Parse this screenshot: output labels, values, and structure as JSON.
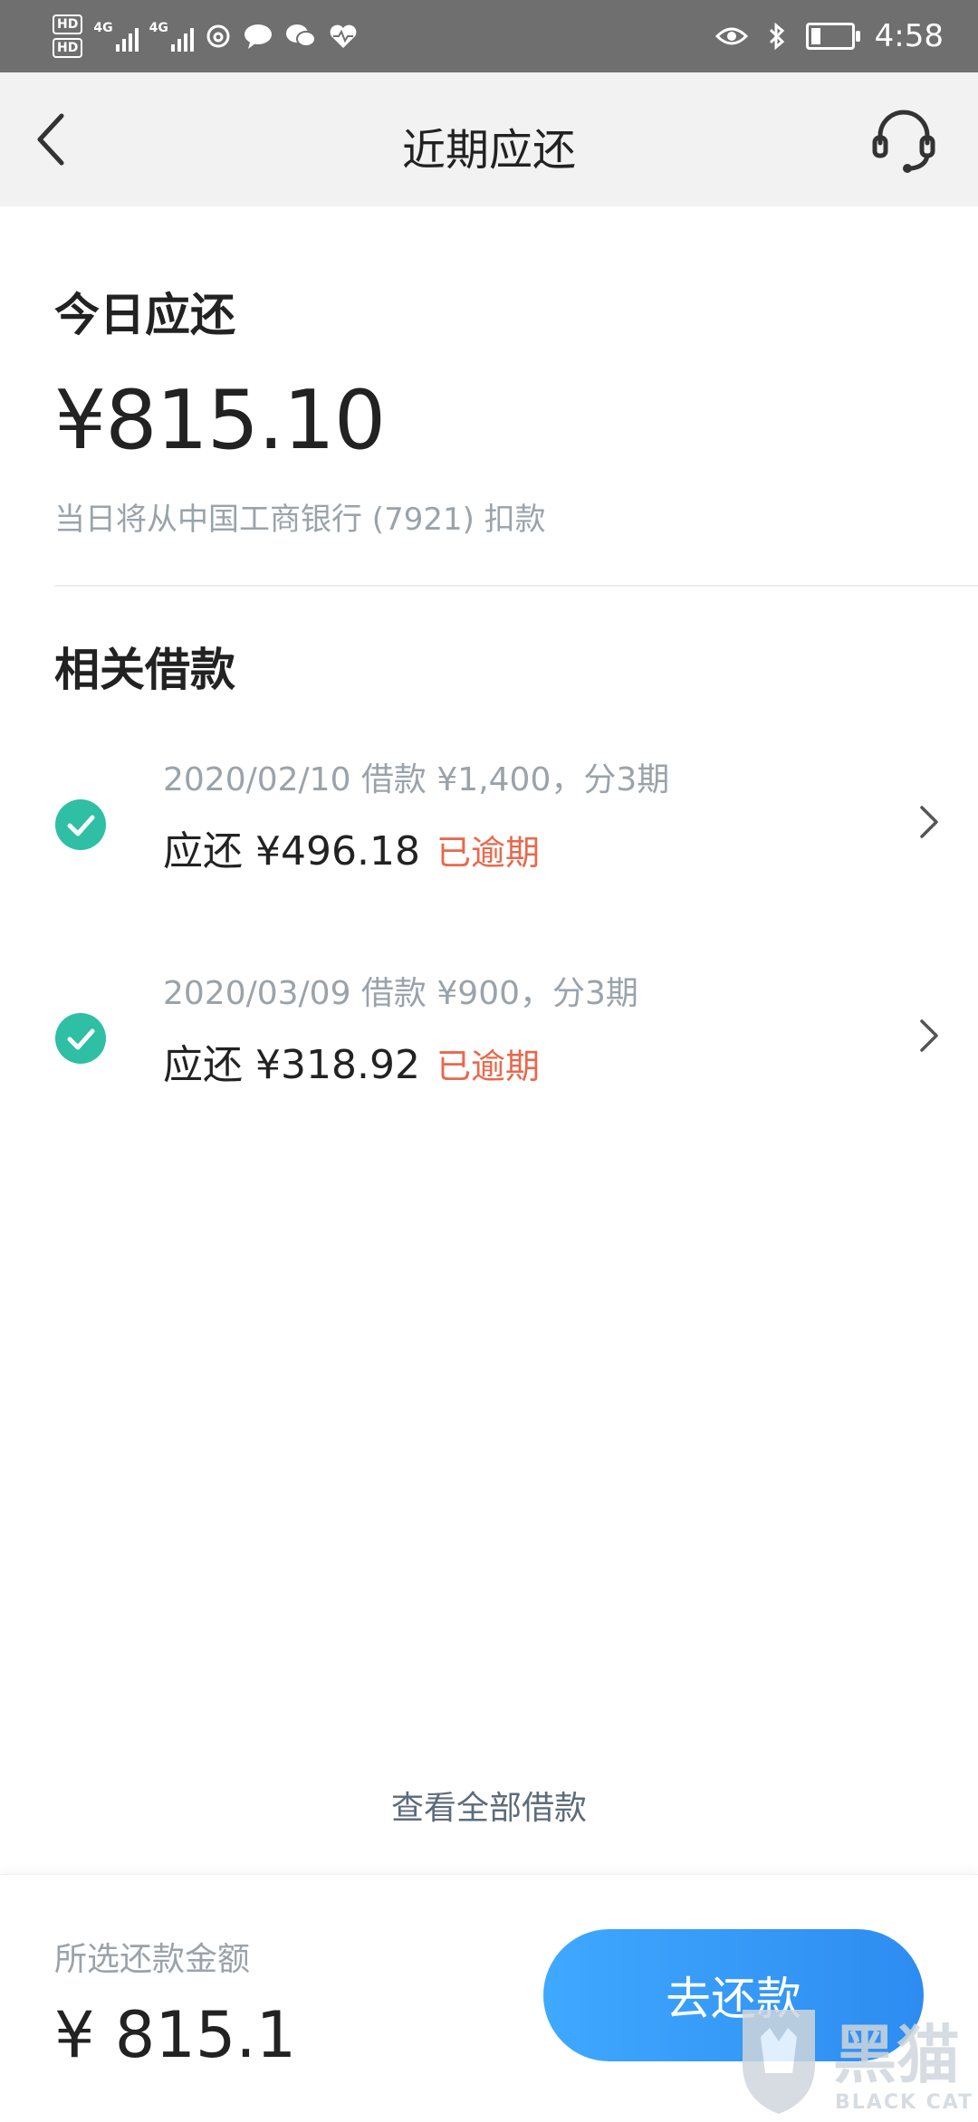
{
  "status_bar": {
    "hd1": "HD",
    "hd2": "HD",
    "sig1_label": "4G",
    "sig2_label": "4G",
    "time": "4:58"
  },
  "header": {
    "title": "近期应还"
  },
  "today": {
    "title": "今日应还",
    "amount": "¥815.10",
    "note": "当日将从中国工商银行 (7921) 扣款"
  },
  "related": {
    "title": "相关借款",
    "loans": [
      {
        "desc": "2020/02/10 借款 ¥1,400，分3期",
        "due": "应还 ¥496.18",
        "status": "已逾期"
      },
      {
        "desc": "2020/03/09 借款 ¥900，分3期",
        "due": "应还 ¥318.92",
        "status": "已逾期"
      }
    ]
  },
  "view_all": "查看全部借款",
  "footer": {
    "selected_label": "所选还款金额",
    "selected_amount": "¥ 815.1",
    "repay_button": "去还款"
  },
  "watermark": {
    "main": "黑猫",
    "sub": "BLACK CAT"
  },
  "colors": {
    "accent": "#2d8cf0",
    "check": "#2ebfa5",
    "overdue": "#e9684c",
    "muted": "#9aa3aa"
  }
}
